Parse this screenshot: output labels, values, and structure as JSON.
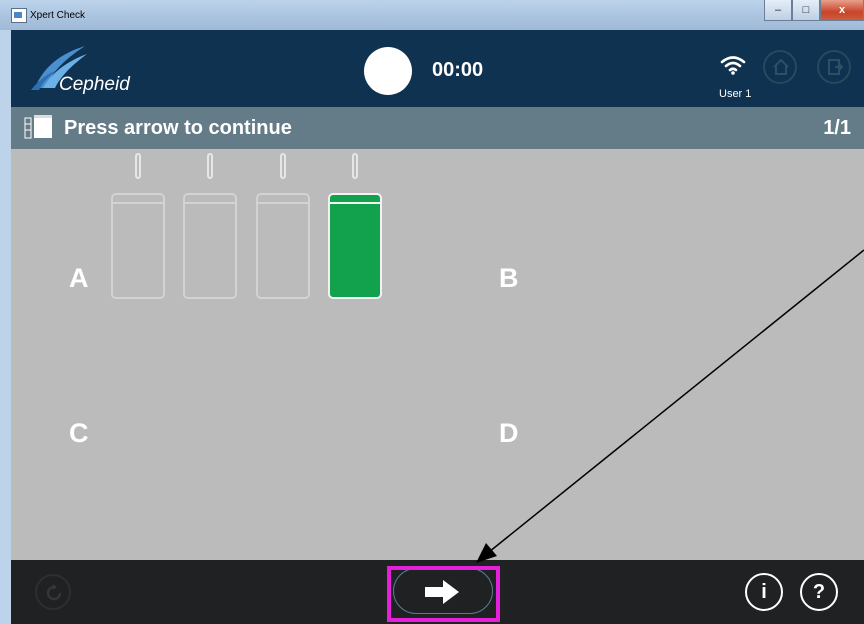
{
  "window": {
    "title": "Xpert Check",
    "minimize_glyph": "–",
    "maximize_glyph": "□",
    "close_glyph": "x"
  },
  "header": {
    "logo_text": "Cepheid",
    "timer": "00:00",
    "user": "User 1",
    "icons": [
      "wifi-icon",
      "home-icon",
      "exit-icon"
    ]
  },
  "status": {
    "message": "Press arrow to continue",
    "page": "1/1"
  },
  "modules": {
    "labels": [
      "A",
      "B",
      "C",
      "D"
    ],
    "A_slots": [
      {
        "state": "empty"
      },
      {
        "state": "empty"
      },
      {
        "state": "empty"
      },
      {
        "state": "active"
      }
    ],
    "active_color": "#12a24d"
  },
  "footer": {
    "info_label": "i",
    "help_label": "?"
  },
  "colors": {
    "header_bg": "#0e3250",
    "status_bg": "#647b88",
    "content_bg": "#bbbbbb",
    "footer_bg": "#1f2123",
    "highlight": "#e520d8"
  }
}
